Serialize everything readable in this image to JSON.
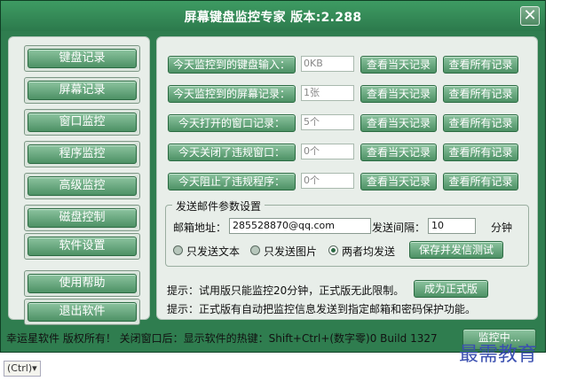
{
  "window": {
    "title": "屏幕键盘监控专家 版本:2.288",
    "close_label": "✕"
  },
  "sidebar": {
    "items": [
      {
        "label": "键盘记录"
      },
      {
        "label": "屏幕记录"
      },
      {
        "label": "窗口监控"
      },
      {
        "label": "程序监控"
      },
      {
        "label": "高级监控"
      },
      {
        "label": "磁盘控制"
      },
      {
        "label": "软件设置"
      },
      {
        "label": "使用帮助"
      },
      {
        "label": "退出软件"
      }
    ]
  },
  "stats": [
    {
      "label": "今天监控到的键盘输入：",
      "value": "0KB",
      "view_today": "查看当天记录",
      "view_all": "查看所有记录"
    },
    {
      "label": "今天监控到的屏幕记录：",
      "value": "1张",
      "view_today": "查看当天记录",
      "view_all": "查看所有记录"
    },
    {
      "label": "今天打开的窗口记录：",
      "value": "5个",
      "view_today": "查看当天记录",
      "view_all": "查看所有记录"
    },
    {
      "label": "今天关闭了违规窗口：",
      "value": "0个",
      "view_today": "查看当天记录",
      "view_all": "查看所有记录"
    },
    {
      "label": "今天阻止了违规程序：",
      "value": "0个",
      "view_today": "查看当天记录",
      "view_all": "查看所有记录"
    }
  ],
  "mail": {
    "group_title": "发送邮件参数设置",
    "address_label": "邮箱地址：",
    "address_value": "285528870@qq.com",
    "interval_label": "发送间隔：",
    "interval_value": "10",
    "interval_unit": "分钟",
    "radio_text": "只发送文本",
    "radio_image": "只发送图片",
    "radio_both": "两者均发送",
    "save_button": "保存并发信测试"
  },
  "hints": {
    "line1": "提示：试用版只能监控20分钟，正式版无此限制。",
    "upgrade_button": "成为正式版",
    "line2": "提示：正式版有自动把监控信息发送到指定邮箱和密码保护功能。"
  },
  "statusbar": {
    "text": "幸运星软件 版权所有！ 关闭窗口后：显示软件的热键：Shift+Ctrl+(数字零)0 Build 1327",
    "button": "监控中..."
  },
  "watermark": "最需教育",
  "below_label": "(Ctrl)▾",
  "colors": {
    "window_bg": "#2f7d4f",
    "panel_bg": "#e8eee9",
    "button_green": "#4d9165"
  }
}
